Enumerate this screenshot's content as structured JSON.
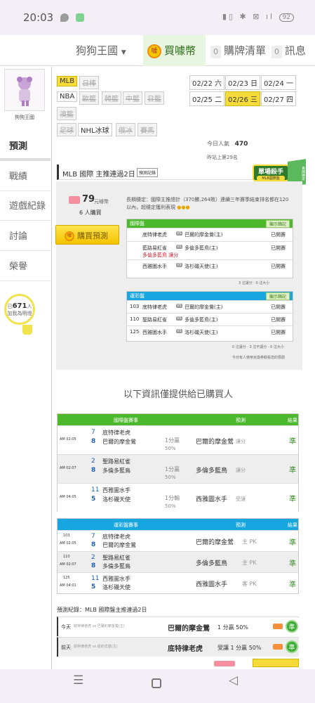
{
  "status_bar": {
    "time": "20:03",
    "battery": "92"
  },
  "top_nav": {
    "brand": "狗狗王國",
    "buy_coins": "買噱幣",
    "purchases": "購牌清單",
    "purchases_count": "0",
    "messages": "訊息",
    "messages_count": "0",
    "coin_glyph": "噱"
  },
  "profile": {
    "name": "狗狗王國"
  },
  "sidebar": {
    "items": [
      "預測",
      "戰績",
      "遊戲紀錄",
      "討論",
      "榮譽"
    ],
    "bulb_count": "671",
    "bulb_label": "加我為明燈",
    "bulb_unit": "人",
    "bulb_prefix": "已"
  },
  "leagues": [
    "MLB",
    "日棒",
    "NBA",
    "歐籃",
    "韓籃",
    "中籃",
    "日籃",
    "澳籃",
    "足球",
    "NHL冰球",
    "俄冰",
    "賽馬"
  ],
  "dates": [
    "02/22 六",
    "02/23 日",
    "02/24 一",
    "02/25 二",
    "02/26 三",
    "02/27 四"
  ],
  "stats": {
    "today_label": "今日人氣",
    "today_value": "470",
    "rank_text": "昨站上第29名"
  },
  "header": {
    "title": "MLB 國際 主推連過2日",
    "history_btn": "預測記錄",
    "badge": "單場殺手",
    "badge_sub": "MLB國際盤",
    "badge_corner": "長期穩定"
  },
  "predict_card": {
    "price": "79",
    "price_unit": "元噱幣",
    "buyers": "6 人購買",
    "buy_btn": "購買預測",
    "desc": "長期穩定：國際主推總計（370勝,264敗）連續三年賽季結束排名都在120以內，超穩定獲利表現",
    "intl_title": "國際盤",
    "filter_btn": "顯示篩記",
    "intl_rows": [
      {
        "a": "底特律老虎",
        "b": "巴爾的摩金鶯(主)",
        "status": "已開賽"
      },
      {
        "a": "藍路易紅雀",
        "b": "多倫多藍鳥(主)",
        "pick": "多倫多藍鳥 讓分",
        "status": "已開賽"
      },
      {
        "a": "西雅圖水手",
        "b": "洛杉磯天使(主)",
        "status": "已開賽"
      }
    ],
    "intl_summary": "3 注讓分 · 0 注大小",
    "tw_title": "運彩盤",
    "tw_rows": [
      {
        "no": "103",
        "a": "底特律老虎",
        "b": "巴爾的摩金鶯(主)",
        "status": "已開賽"
      },
      {
        "no": "110",
        "a": "聖路易紅雀",
        "b": "多倫多藍鳥(主)",
        "status": "已開賽"
      },
      {
        "no": "125",
        "a": "西雅圖水手",
        "b": "洛杉磯天使(主)",
        "status": "已開賽"
      }
    ],
    "tw_summary": "0 注讓分 · 3 注不讓分 · 0 注大小",
    "footnote": "今日有人使用兌換券觀看您的預測"
  },
  "buyers_notice": "以下資訊僅提供給已購買人",
  "intl_table": {
    "headers": [
      "國際盤賽事",
      "預測",
      "結果"
    ],
    "rows": [
      {
        "time": "AM 02:05",
        "s1": "7",
        "s2": "8",
        "t1": "底特律老虎",
        "t2": "巴爾的摩金鶯",
        "line1": "1分贏",
        "line2": "50%",
        "pick": "巴爾的摩金鶯",
        "type": "讓分",
        "result": "準"
      },
      {
        "time": "AM 02:07",
        "s1": "2",
        "s2": "8",
        "t1": "聖路易紅雀",
        "t2": "多倫多藍鳥",
        "line1": "1分贏",
        "line2": "50%",
        "pick": "多倫多藍鳥",
        "type": "讓分",
        "result": "準"
      },
      {
        "time": "AM 04:05",
        "s1": "11",
        "s2": "5",
        "t1": "西雅圖水手",
        "t2": "洛杉磯天使",
        "line1": "1分輸",
        "line2": "50%",
        "pick": "西雅圖水手",
        "type": "受讓",
        "result": "準"
      }
    ]
  },
  "tw_table": {
    "headers": [
      "運彩盤賽事",
      "預測",
      "結果"
    ],
    "rows": [
      {
        "no": "103",
        "time": "AM 02:05",
        "s1": "7",
        "s2": "8",
        "t1": "底特律老虎",
        "t2": "巴爾的摩金鶯",
        "pick": "巴爾的摩金鶯",
        "type": "主 PK",
        "result": "準"
      },
      {
        "no": "110",
        "time": "AM 02:07",
        "s1": "2",
        "s2": "8",
        "t1": "聖路易紅雀",
        "t2": "多倫多藍鳥",
        "pick": "多倫多藍鳥",
        "type": "主 PK",
        "result": "準"
      },
      {
        "no": "125",
        "time": "AM 04:01",
        "s1": "11",
        "s2": "5",
        "t1": "西雅圖水手",
        "t2": "洛杉磯天使",
        "pick": "西雅圖水手",
        "type": "客 PK",
        "result": "準"
      }
    ]
  },
  "record": {
    "title": "預測紀錄：MLB 國際盤主推連過2日",
    "rows": [
      {
        "day": "今天",
        "match": "底特律老虎 vs 巴爾的摩金鶯(主)",
        "pick": "巴爾的摩金鶯",
        "line": "1 分贏 50%",
        "result": "準"
      },
      {
        "day": "前天",
        "match": "底特律老虎 vs 紐約洋基(主)",
        "pick": "底特律老虎",
        "line": "受讓 1 分贏 50%",
        "result": "準"
      }
    ]
  },
  "colors": {
    "green": "#4cb82c",
    "blue": "#17a6e0",
    "yellow": "#f6dc3b"
  }
}
